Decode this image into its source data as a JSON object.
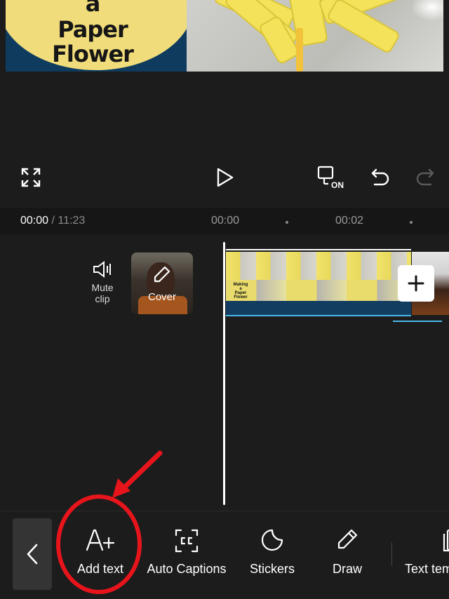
{
  "preview": {
    "title_lines": [
      "a",
      "Paper",
      "Flower"
    ]
  },
  "controls": {
    "fullscreen_icon": "fullscreen-icon",
    "play_icon": "play-icon",
    "keyframe_toggle_label": "ON",
    "undo_icon": "undo-icon",
    "redo_icon": "redo-icon"
  },
  "timeline": {
    "current_time": "00:00",
    "separator": " / ",
    "total_time": "11:23",
    "ruler_marks": [
      "00:00",
      "00:02"
    ]
  },
  "track": {
    "mute_label_1": "Mute",
    "mute_label_2": "clip",
    "cover_label": "Cover",
    "clip_thumb_text": [
      "Making",
      "a",
      "Paper",
      "Flower"
    ],
    "add_clip_icon": "plus-icon"
  },
  "toolbar": {
    "items": [
      {
        "label": "Add text",
        "icon": "add-text-icon"
      },
      {
        "label": "Auto Captions",
        "icon": "captions-icon"
      },
      {
        "label": "Stickers",
        "icon": "sticker-icon"
      },
      {
        "label": "Draw",
        "icon": "pencil-icon"
      },
      {
        "label": "Text tem",
        "icon": "text-template-icon"
      }
    ],
    "back_icon": "chevron-left-icon"
  },
  "annotation": {
    "highlight_color": "#e8141b"
  }
}
